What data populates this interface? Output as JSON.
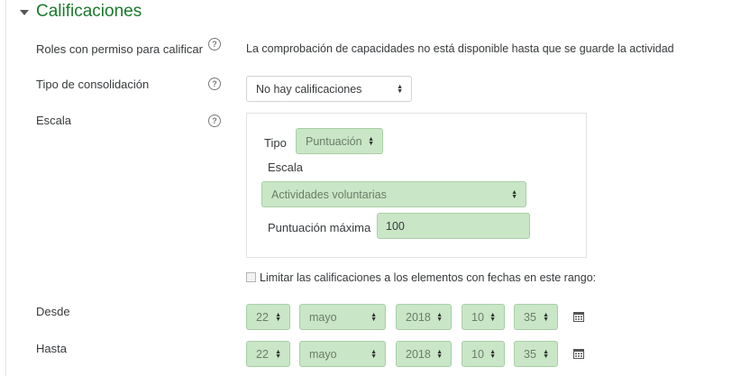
{
  "section": {
    "title": "Calificaciones"
  },
  "roles": {
    "label": "Roles con permiso para calificar",
    "message": "La comprobación de capacidades no está disponible hasta que se guarde la actividad"
  },
  "consolidation": {
    "label": "Tipo de consolidación",
    "value": "No hay calificaciones"
  },
  "scale": {
    "label": "Escala",
    "type_label": "Tipo",
    "type_value": "Puntuación",
    "scale_label": "Escala",
    "scale_value": "Actividades voluntarias",
    "max_label": "Puntuación máxima",
    "max_value": "100"
  },
  "limit": {
    "label": "Limitar las calificaciones a los elementos con fechas en este rango:",
    "checked": false
  },
  "from": {
    "label": "Desde",
    "day": "22",
    "month": "mayo",
    "year": "2018",
    "hour": "10",
    "minute": "35"
  },
  "to": {
    "label": "Hasta",
    "day": "22",
    "month": "mayo",
    "year": "2018",
    "hour": "10",
    "minute": "35"
  },
  "icons": {
    "help": "question-circle-icon",
    "calendar": "calendar-icon",
    "section_toggle": "caret-down-icon"
  },
  "colors": {
    "section_title": "#1a7a2b",
    "disabled_field_bg": "#c9e6c7"
  }
}
